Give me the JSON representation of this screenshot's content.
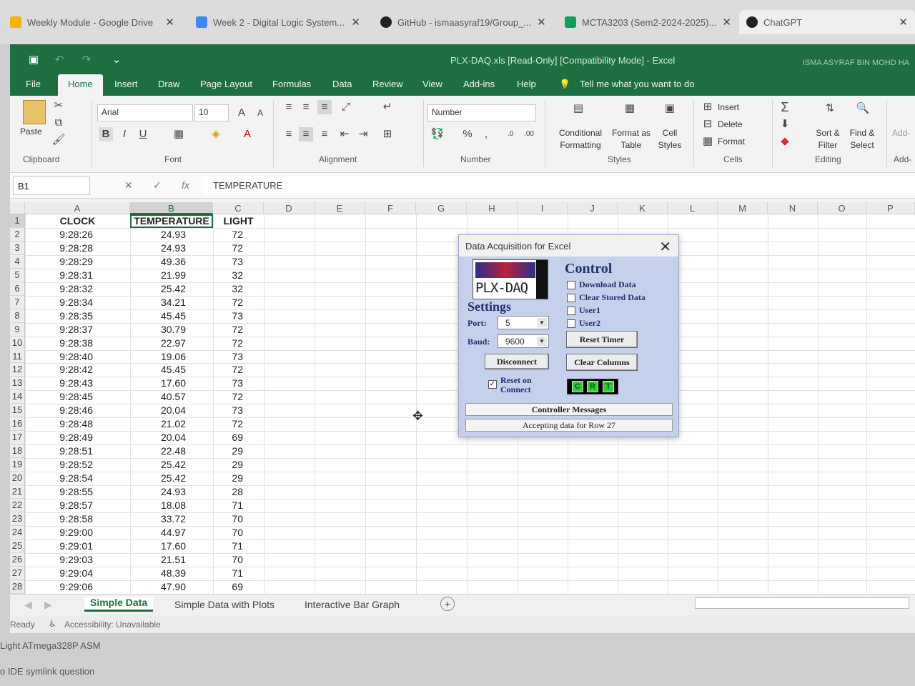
{
  "browser": {
    "tabs": [
      {
        "label": "Weekly Module - Google Drive",
        "icon": "google-drive-icon",
        "color": "#f4b400"
      },
      {
        "label": "Week 2 - Digital Logic System...",
        "icon": "google-docs-icon",
        "color": "#4285f4"
      },
      {
        "label": "GitHub - ismaasyraf19/Group_...",
        "icon": "github-icon",
        "color": "#222222"
      },
      {
        "label": "MCTA3203 (Sem2-2024-2025)...",
        "icon": "google-sheets-icon",
        "color": "#0f9d58"
      },
      {
        "label": "ChatGPT",
        "icon": "chatgpt-icon",
        "color": "#222222"
      }
    ]
  },
  "excel": {
    "title": "PLX-DAQ.xls  [Read-Only]  [Compatibility Mode]  -  Excel",
    "user": "ISMA ASYRAF BIN MOHD HA",
    "ribbon_tabs": [
      "File",
      "Home",
      "Insert",
      "Draw",
      "Page Layout",
      "Formulas",
      "Data",
      "Review",
      "View",
      "Add-ins",
      "Help"
    ],
    "tell_me": "Tell me what you want to do",
    "clipboard": {
      "paste": "Paste",
      "label": "Clipboard"
    },
    "font": {
      "name": "Arial",
      "size": "10",
      "label": "Font",
      "bold": "B",
      "italic": "I",
      "underline": "U"
    },
    "alignment": {
      "label": "Alignment"
    },
    "number": {
      "format": "Number",
      "label": "Number",
      "percent": "%"
    },
    "styles": {
      "conditional": "Conditional Formatting",
      "format_table": "Format as Table",
      "cell_styles": "Cell Styles",
      "label": "Styles"
    },
    "cells": {
      "insert": "Insert",
      "delete": "Delete",
      "format": "Format",
      "label": "Cells"
    },
    "editing": {
      "sort": "Sort & Filter",
      "find": "Find & Select",
      "label": "Editing"
    },
    "addins": {
      "btn": "Add-",
      "label": "Add-"
    },
    "name_box": "B1",
    "formula": "TEMPERATURE",
    "columns": [
      "A",
      "B",
      "C",
      "D",
      "E",
      "F",
      "G",
      "H",
      "I",
      "J",
      "K",
      "L",
      "M",
      "N",
      "O",
      "P"
    ],
    "headers": {
      "a": "CLOCK",
      "b": "TEMPERATURE",
      "c": "LIGHT"
    },
    "rows": [
      {
        "n": "1"
      },
      {
        "n": "2",
        "clock": "9:28:26",
        "temp": "24.93",
        "light": "72"
      },
      {
        "n": "3",
        "clock": "9:28:28",
        "temp": "24.93",
        "light": "72"
      },
      {
        "n": "4",
        "clock": "9:28:29",
        "temp": "49.36",
        "light": "73"
      },
      {
        "n": "5",
        "clock": "9:28:31",
        "temp": "21.99",
        "light": "32"
      },
      {
        "n": "6",
        "clock": "9:28:32",
        "temp": "25.42",
        "light": "32"
      },
      {
        "n": "7",
        "clock": "9:28:34",
        "temp": "34.21",
        "light": "72"
      },
      {
        "n": "8",
        "clock": "9:28:35",
        "temp": "45.45",
        "light": "73"
      },
      {
        "n": "9",
        "clock": "9:28:37",
        "temp": "30.79",
        "light": "72"
      },
      {
        "n": "10",
        "clock": "9:28:38",
        "temp": "22.97",
        "light": "72"
      },
      {
        "n": "11",
        "clock": "9:28:40",
        "temp": "19.06",
        "light": "73"
      },
      {
        "n": "12",
        "clock": "9:28:42",
        "temp": "45.45",
        "light": "72"
      },
      {
        "n": "13",
        "clock": "9:28:43",
        "temp": "17.60",
        "light": "73"
      },
      {
        "n": "14",
        "clock": "9:28:45",
        "temp": "40.57",
        "light": "72"
      },
      {
        "n": "15",
        "clock": "9:28:46",
        "temp": "20.04",
        "light": "73"
      },
      {
        "n": "16",
        "clock": "9:28:48",
        "temp": "21.02",
        "light": "72"
      },
      {
        "n": "17",
        "clock": "9:28:49",
        "temp": "20.04",
        "light": "69"
      },
      {
        "n": "18",
        "clock": "9:28:51",
        "temp": "22.48",
        "light": "29"
      },
      {
        "n": "19",
        "clock": "9:28:52",
        "temp": "25.42",
        "light": "29"
      },
      {
        "n": "20",
        "clock": "9:28:54",
        "temp": "25.42",
        "light": "29"
      },
      {
        "n": "21",
        "clock": "9:28:55",
        "temp": "24.93",
        "light": "28"
      },
      {
        "n": "22",
        "clock": "9:28:57",
        "temp": "18.08",
        "light": "71"
      },
      {
        "n": "23",
        "clock": "9:28:58",
        "temp": "33.72",
        "light": "70"
      },
      {
        "n": "24",
        "clock": "9:29:00",
        "temp": "44.97",
        "light": "70"
      },
      {
        "n": "25",
        "clock": "9:29:01",
        "temp": "17.60",
        "light": "71"
      },
      {
        "n": "26",
        "clock": "9:29:03",
        "temp": "21.51",
        "light": "70"
      },
      {
        "n": "27",
        "clock": "9:29:04",
        "temp": "48.39",
        "light": "71"
      },
      {
        "n": "28",
        "clock": "9:29:06",
        "temp": "47.90",
        "light": "69"
      }
    ],
    "sheets": [
      "Simple Data",
      "Simple Data with Plots",
      "Interactive Bar Graph"
    ],
    "status": {
      "ready": "Ready",
      "accessibility": "Accessibility: Unavailable"
    }
  },
  "below_window": [
    "Light ATmega328P ASM",
    "o IDE symlink question"
  ],
  "dialog": {
    "title": "Data Acquisition for Excel",
    "logo_text": "PLX-DAQ",
    "settings": "Settings",
    "port_label": "Port:",
    "port": "5",
    "baud_label": "Baud:",
    "baud": "9600",
    "disconnect": "Disconnect",
    "reset_on_connect": "Reset on Connect",
    "control": "Control",
    "download_data": "Download Data",
    "clear_stored_data": "Clear Stored Data",
    "user1": "User1",
    "user2": "User2",
    "reset_timer": "Reset Timer",
    "clear_columns": "Clear Columns",
    "crt": [
      "C",
      "R",
      "T"
    ],
    "controller_messages": "Controller Messages",
    "status_message": "Accepting data for Row 27"
  }
}
